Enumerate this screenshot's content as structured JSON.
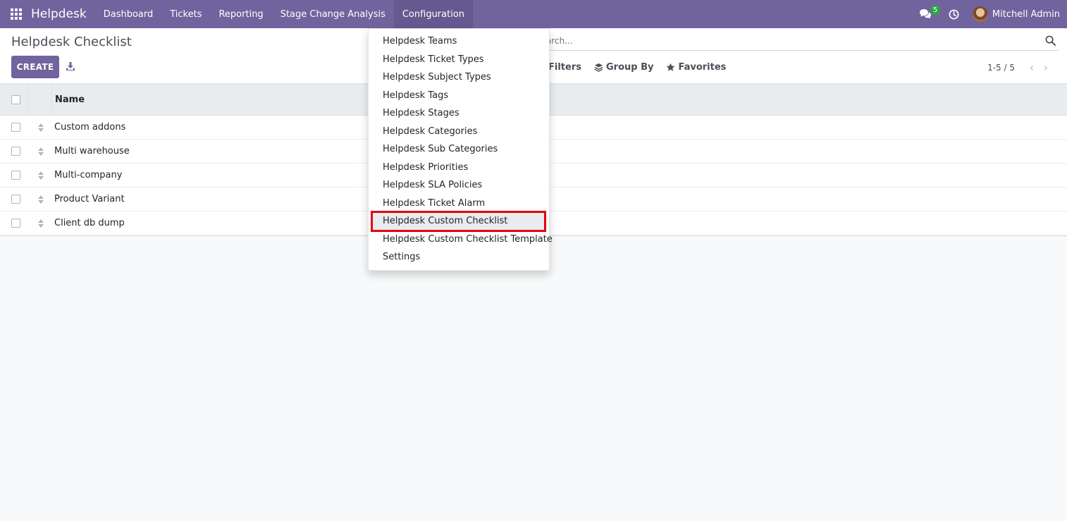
{
  "navbar": {
    "brand": "Helpdesk",
    "menus": [
      "Dashboard",
      "Tickets",
      "Reporting",
      "Stage Change Analysis",
      "Configuration"
    ],
    "chat_count": "5",
    "user_name": "Mitchell Admin",
    "accent": "#71639e"
  },
  "control": {
    "title": "Helpdesk Checklist",
    "create_label": "CREATE",
    "search_placeholder": "Search...",
    "filters_label": "Filters",
    "groupby_label": "Group By",
    "favorites_label": "Favorites",
    "pager_value": "1-5 / 5"
  },
  "list": {
    "column_name": "Name",
    "rows": [
      "Custom addons",
      "Multi warehouse",
      "Multi-company",
      "Product Variant",
      "Client db dump"
    ]
  },
  "config_menu": {
    "items": [
      "Helpdesk Teams",
      "Helpdesk Ticket Types",
      "Helpdesk Subject Types",
      "Helpdesk Tags",
      "Helpdesk Stages",
      "Helpdesk Categories",
      "Helpdesk Sub Categories",
      "Helpdesk Priorities",
      "Helpdesk SLA Policies",
      "Helpdesk Ticket Alarm",
      "Helpdesk Custom Checklist",
      "Helpdesk Custom Checklist Template",
      "Settings"
    ],
    "highlighted": "Helpdesk Custom Checklist",
    "highlight_color": "#e3000f"
  }
}
